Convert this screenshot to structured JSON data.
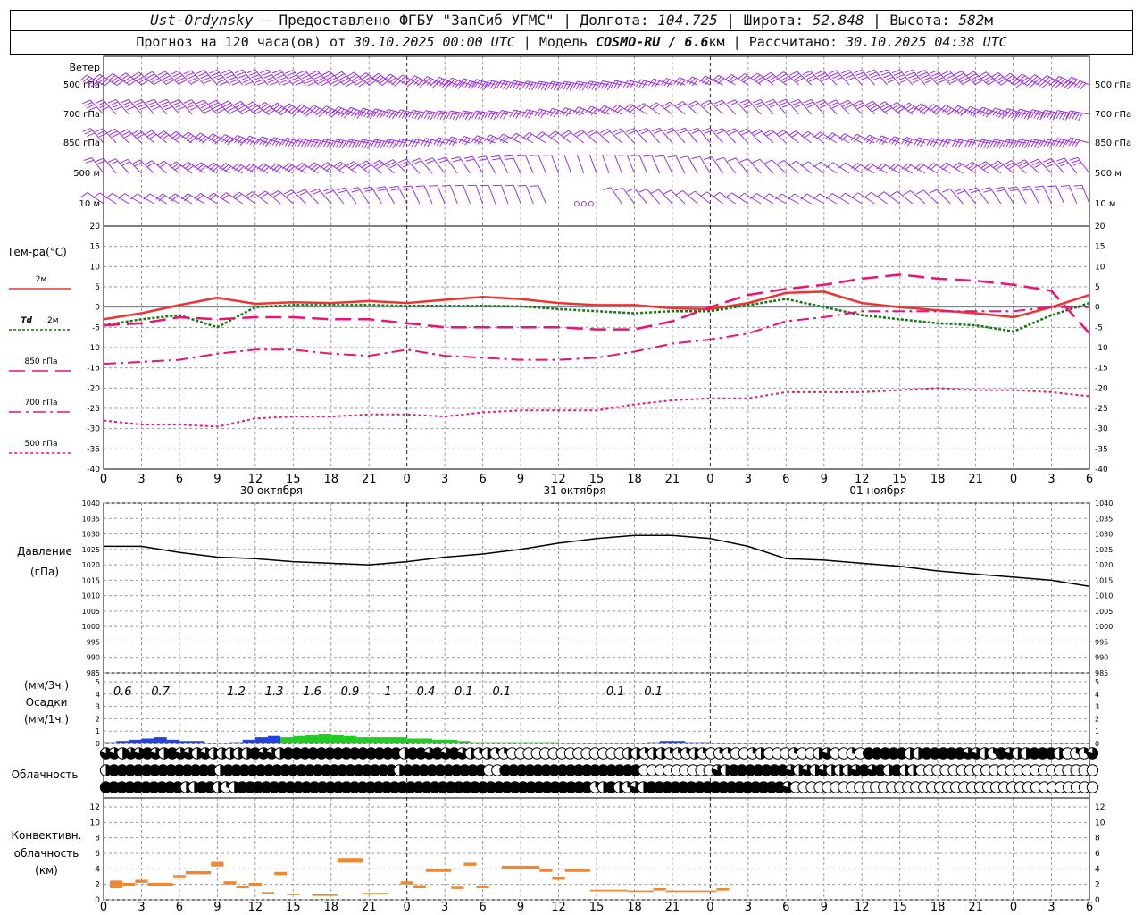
{
  "header": {
    "station": "Ust-Ordynsky",
    "provider": "— Предоставлено ФГБУ \"ЗапСиб УГМС\"",
    "lon_label": "Долгота:",
    "lon_value": "104.725",
    "lat_label": "Широта:",
    "lat_value": "52.848",
    "alt_label": "Высота:",
    "alt_value": "582",
    "alt_unit": "м",
    "forecast_label": "Прогноз на 120 часа(ов) от",
    "forecast_start": "30.10.2025 00:00 UTC",
    "model_label": "Модель",
    "model_name": "COSMO-RU / 6.6",
    "model_unit": "км",
    "computed_label": "Рассчитано:",
    "computed_value": "30.10.2025 04:38 UTC"
  },
  "labels": {
    "wind": "Ветер",
    "temp": "Тем-ра(°C)",
    "t2m": "2м",
    "td_a": "Td",
    "td_b": "2м",
    "t850": "850 гПа",
    "t700": "700 гПа",
    "t500": "500 гПа",
    "pressure_a": "Давление",
    "pressure_b": "(гПа)",
    "precip_a": "(мм/3ч.)",
    "precip_b": "Осадки",
    "precip_c": "(мм/1ч.)",
    "cloud": "Облачность",
    "conv_a": "Конвективн.",
    "conv_b": "облачность",
    "conv_c": "(км)"
  },
  "colors": {
    "wind": "#9b30e8",
    "t2m": "#ee3333",
    "td": "#117711",
    "t_upper": "#ee1177",
    "precip_light": "#2244dd",
    "precip_heavy": "#22cc22",
    "convective": "#ee8833",
    "pressure": "#000000",
    "grid": "#999999"
  },
  "chart_data": {
    "type": "line",
    "x_hours_utc": [
      0,
      3,
      6,
      9,
      12,
      15,
      18,
      21,
      0,
      3,
      6,
      9,
      12,
      15,
      18,
      21,
      0,
      3,
      6,
      9,
      12,
      15,
      18,
      21,
      0,
      3,
      6
    ],
    "dates": [
      "30 октября",
      "31 октября",
      "01 ноября"
    ],
    "wind": {
      "levels": [
        "500 гПа",
        "700 гПа",
        "850 гПа",
        "500 м",
        "10 м"
      ],
      "right_levels": [
        "500 гПа",
        "700 гПа",
        "850 гПа",
        "500 м",
        "10 м"
      ]
    },
    "temperature": {
      "ylim": [
        -40,
        20
      ],
      "ticks": [
        20,
        15,
        10,
        5,
        0,
        -5,
        -10,
        -15,
        -20,
        -25,
        -30,
        -35,
        -40
      ],
      "x": [
        0,
        3,
        6,
        9,
        12,
        15,
        18,
        21,
        24,
        27,
        30,
        33,
        36,
        39,
        42,
        45,
        48,
        51,
        54,
        57,
        60,
        63,
        66,
        69,
        72,
        75,
        78
      ],
      "series": [
        {
          "name": "2м",
          "values": [
            -3,
            -1.5,
            0.5,
            2.3,
            0.8,
            1.2,
            1,
            1.5,
            1,
            1.8,
            2.5,
            2,
            1,
            0.5,
            0.5,
            -0.3,
            -0.5,
            1,
            3.5,
            3.8,
            1,
            0,
            -0.8,
            -1.5,
            -2.5,
            0,
            3
          ]
        },
        {
          "name": "Td 2м",
          "values": [
            -4.5,
            -3,
            -2,
            -5,
            0,
            0.5,
            0.5,
            0.5,
            0.3,
            0.3,
            0.3,
            0.2,
            -0.5,
            -1,
            -1.5,
            -1,
            -1,
            0.5,
            2,
            0,
            -2,
            -3,
            -4,
            -4.5,
            -6,
            -2,
            1
          ]
        },
        {
          "name": "850 гПа",
          "values": [
            -4.5,
            -4,
            -2.5,
            -3,
            -2.5,
            -2.5,
            -3,
            -3,
            -4,
            -5,
            -5,
            -5,
            -5,
            -5.5,
            -5.5,
            -3.5,
            0,
            3,
            4.5,
            5.5,
            7,
            8,
            7,
            6.5,
            5.5,
            4,
            -6.5
          ]
        },
        {
          "name": "700 гПа",
          "values": [
            -14,
            -13.5,
            -13,
            -11.5,
            -10.5,
            -10.5,
            -11.5,
            -12,
            -10.5,
            -12,
            -12.5,
            -13,
            -13,
            -12.5,
            -11,
            -9,
            -8,
            -6.5,
            -3.5,
            -2.5,
            -1,
            -1,
            -1,
            -1,
            -1,
            0,
            0
          ]
        },
        {
          "name": "500 гПа",
          "values": [
            -28,
            -29,
            -29,
            -29.5,
            -27.5,
            -27,
            -27,
            -26.5,
            -26.5,
            -27,
            -26,
            -25.5,
            -25.5,
            -25.5,
            -24,
            -23,
            -22.5,
            -22.5,
            -21,
            -21,
            -21,
            -20.5,
            -20,
            -20.5,
            -20.5,
            -21,
            -22
          ]
        }
      ]
    },
    "pressure": {
      "ylim": [
        985,
        1040
      ],
      "ticks": [
        1040,
        1035,
        1030,
        1025,
        1020,
        1015,
        1010,
        1005,
        1000,
        995,
        990,
        985
      ],
      "x": [
        0,
        3,
        6,
        9,
        12,
        15,
        18,
        21,
        24,
        27,
        30,
        33,
        36,
        39,
        42,
        45,
        48,
        51,
        54,
        57,
        60,
        63,
        66,
        69,
        72,
        75,
        78
      ],
      "values": [
        1026,
        1026,
        1024,
        1022.5,
        1022,
        1021,
        1020.5,
        1020,
        1021,
        1022.5,
        1023.5,
        1025,
        1027,
        1028.5,
        1029.5,
        1029.5,
        1028.5,
        1026,
        1022,
        1021.5,
        1020.5,
        1019.5,
        1018,
        1017,
        1016,
        1015,
        1013
      ]
    },
    "precipitation": {
      "ylim": [
        0,
        5
      ],
      "ticks": [
        5,
        4,
        3,
        2,
        1,
        0
      ],
      "totals_3h": [
        {
          "hour": 1.5,
          "value": "0.6"
        },
        {
          "hour": 4.5,
          "value": "0.7"
        },
        {
          "hour": 10.5,
          "value": "1.2"
        },
        {
          "hour": 13.5,
          "value": "1.3"
        },
        {
          "hour": 16.5,
          "value": "1.6"
        },
        {
          "hour": 19.5,
          "value": "0.9"
        },
        {
          "hour": 22.5,
          "value": "1"
        },
        {
          "hour": 25.5,
          "value": "0.4"
        },
        {
          "hour": 28.5,
          "value": "0.1"
        },
        {
          "hour": 31.5,
          "value": "0.1"
        },
        {
          "hour": 40.5,
          "value": "0.1"
        },
        {
          "hour": 43.5,
          "value": "0.1"
        }
      ],
      "hourly_light": [
        0.1,
        0.2,
        0.3,
        0.4,
        0.5,
        0.3,
        0.2,
        0.2,
        0,
        0,
        0.1,
        0.3,
        0.5,
        0.6,
        0.4,
        0.3,
        0.3,
        0.3,
        0.2,
        0.2,
        0.2,
        0.2,
        0.3,
        0.3,
        0.2,
        0.1,
        0.1,
        0,
        0,
        0,
        0,
        0,
        0,
        0,
        0,
        0,
        0,
        0,
        0,
        0,
        0,
        0,
        0,
        0.1,
        0.2,
        0.2,
        0.1,
        0.1
      ],
      "hourly_heavy": [
        0,
        0,
        0,
        0,
        0,
        0,
        0,
        0,
        0,
        0,
        0,
        0,
        0,
        0,
        0.5,
        0.6,
        0.7,
        0.8,
        0.7,
        0.6,
        0.5,
        0.5,
        0.5,
        0.5,
        0.4,
        0.4,
        0.3,
        0.3,
        0.2,
        0.1,
        0.1,
        0.1,
        0.1,
        0.1,
        0.1,
        0.1,
        0,
        0,
        0,
        0,
        0,
        0,
        0,
        0,
        0,
        0,
        0,
        0
      ]
    },
    "cloudiness": {
      "rows": 3,
      "note": "fraction of cloud cover per hour (0..1), rows top=high, middle=mid, bottom=low",
      "high": [
        0.8,
        0.8,
        0.5,
        0.9,
        0.8,
        1,
        0.8,
        0.5,
        1,
        0.8,
        0.8,
        0.5,
        0.8,
        0.5,
        0.5,
        0.5,
        0.5,
        0.5,
        1,
        0.8,
        0.8,
        0.5,
        1,
        1,
        1,
        1,
        1,
        1,
        1,
        1,
        1,
        1,
        1,
        1,
        1,
        1,
        0.5,
        1,
        1,
        0.8,
        1,
        0.8,
        1,
        0.8,
        0.5,
        0.3,
        0.5,
        0.3,
        0.3,
        0,
        0,
        0,
        0,
        0,
        0,
        0,
        0,
        0,
        0,
        0,
        0,
        0,
        0,
        0.5,
        0.5,
        0.3,
        0.5,
        0.5,
        0.3,
        0.3,
        0.3,
        0.5,
        0.3,
        0,
        0.3,
        0.3,
        0,
        0,
        0.3,
        0.5,
        0,
        0,
        0,
        0.3,
        0,
        0,
        0.5,
        0.8,
        0,
        0,
        0.3,
        0,
        1,
        1,
        1,
        1,
        1,
        0.5,
        0.5,
        1,
        1,
        1,
        1,
        1,
        0.8,
        0.8,
        0.5,
        0.3,
        1,
        0.8,
        0.5,
        0.5,
        1,
        1,
        1,
        0.5,
        0,
        0.3,
        0.3,
        0.8
      ],
      "mid": [
        0.5,
        1,
        1,
        1,
        1,
        1,
        1,
        1,
        1,
        1,
        1,
        1,
        1,
        1,
        0.5,
        1,
        1,
        1,
        1,
        1,
        1,
        1,
        1,
        1,
        1,
        1,
        1,
        1,
        1,
        1,
        1,
        1,
        1,
        1,
        1,
        1,
        0.5,
        1,
        1,
        1,
        1,
        1,
        1,
        1,
        1,
        1,
        1,
        0,
        0,
        1,
        1,
        1,
        1,
        1,
        1,
        1,
        1,
        1,
        1,
        1,
        1,
        1,
        1,
        1,
        1,
        1,
        0,
        0,
        0,
        0,
        0,
        0,
        0,
        0,
        0,
        0.8,
        0.5,
        1,
        1,
        1,
        1,
        1,
        1,
        1,
        0.8,
        0.5,
        0.8,
        0.5,
        0.8,
        0.5,
        0.5,
        0.5,
        0.8,
        1,
        0.8,
        1,
        0.5,
        1,
        0.5,
        0.5,
        0,
        0,
        0,
        0,
        0,
        0,
        0,
        0,
        0,
        0,
        0,
        0,
        0,
        0,
        0,
        0,
        0,
        0,
        0,
        0,
        0,
        0
      ],
      "low": [
        1,
        1,
        1,
        1,
        1,
        1,
        1,
        1,
        1,
        1,
        0.5,
        0.5,
        1,
        1,
        0.5,
        0.3,
        0.5,
        1,
        1,
        1,
        1,
        1,
        1,
        1,
        1,
        1,
        1,
        1,
        1,
        1,
        1,
        1,
        1,
        1,
        1,
        1,
        1,
        1,
        1,
        1,
        1,
        1,
        1,
        1,
        1,
        1,
        1,
        1,
        1,
        1,
        1,
        1,
        1,
        1,
        1,
        1,
        1,
        1,
        1,
        1,
        1,
        0.3,
        0.5,
        1,
        0.5,
        0.3,
        0.8,
        0.5,
        1,
        1,
        1,
        1,
        1,
        1,
        1,
        1,
        1,
        1,
        1,
        1,
        1,
        1,
        1,
        1,
        1,
        0.8,
        0,
        0,
        0,
        0,
        0,
        0,
        0,
        0,
        0,
        0,
        0,
        0,
        0,
        0,
        0,
        0,
        0,
        0,
        0,
        0,
        0,
        0,
        0,
        0,
        0,
        0,
        0,
        0,
        0,
        0,
        0,
        0,
        0,
        0,
        0,
        0,
        0,
        0
      ]
    },
    "convective": {
      "ylim": [
        0,
        12
      ],
      "ticks": [
        12,
        10,
        8,
        6,
        4,
        2,
        0
      ],
      "segments": [
        {
          "start": 0.5,
          "end": 1.5,
          "base": 1.5,
          "top": 2.5
        },
        {
          "start": 1.5,
          "end": 2.5,
          "base": 1.8,
          "top": 2.2
        },
        {
          "start": 2.5,
          "end": 3.5,
          "base": 2.2,
          "top": 2.6
        },
        {
          "start": 3.5,
          "end": 5.5,
          "base": 1.8,
          "top": 2.2
        },
        {
          "start": 5.5,
          "end": 6.5,
          "base": 2.8,
          "top": 3.2
        },
        {
          "start": 6.5,
          "end": 8.5,
          "base": 3.3,
          "top": 3.7
        },
        {
          "start": 8.5,
          "end": 9.5,
          "base": 4.3,
          "top": 4.9
        },
        {
          "start": 9.5,
          "end": 10.5,
          "base": 2,
          "top": 2.4
        },
        {
          "start": 10.5,
          "end": 11.5,
          "base": 1.5,
          "top": 1.8
        },
        {
          "start": 11.5,
          "end": 12.5,
          "base": 1.8,
          "top": 2.2
        },
        {
          "start": 12.5,
          "end": 13.5,
          "base": 0.8,
          "top": 1.0
        },
        {
          "start": 13.5,
          "end": 14.5,
          "base": 3.2,
          "top": 3.6
        },
        {
          "start": 14.5,
          "end": 15.5,
          "base": 0.6,
          "top": 0.8
        },
        {
          "start": 16.5,
          "end": 18.5,
          "base": 0.5,
          "top": 0.7
        },
        {
          "start": 18.5,
          "end": 20.5,
          "base": 4.8,
          "top": 5.4
        },
        {
          "start": 20.5,
          "end": 22.5,
          "base": 0.7,
          "top": 0.9
        },
        {
          "start": 23.5,
          "end": 24.5,
          "base": 2.0,
          "top": 2.4
        },
        {
          "start": 24.5,
          "end": 25.5,
          "base": 1.5,
          "top": 1.9
        },
        {
          "start": 25.5,
          "end": 27.5,
          "base": 3.6,
          "top": 4.0
        },
        {
          "start": 27.5,
          "end": 28.5,
          "base": 1.4,
          "top": 1.7
        },
        {
          "start": 28.5,
          "end": 29.5,
          "base": 4.4,
          "top": 4.8
        },
        {
          "start": 29.5,
          "end": 30.5,
          "base": 1.5,
          "top": 1.8
        },
        {
          "start": 31.5,
          "end": 34.5,
          "base": 4.0,
          "top": 4.4
        },
        {
          "start": 34.5,
          "end": 35.5,
          "base": 3.6,
          "top": 4.0
        },
        {
          "start": 35.5,
          "end": 36.5,
          "base": 2.6,
          "top": 3.0
        },
        {
          "start": 36.5,
          "end": 38.5,
          "base": 3.6,
          "top": 4.0
        },
        {
          "start": 38.5,
          "end": 41.5,
          "base": 1.1,
          "top": 1.3
        },
        {
          "start": 41.5,
          "end": 43.5,
          "base": 1.0,
          "top": 1.2
        },
        {
          "start": 43.5,
          "end": 44.5,
          "base": 1.2,
          "top": 1.5
        },
        {
          "start": 44.5,
          "end": 48.5,
          "base": 1.0,
          "top": 1.2
        },
        {
          "start": 48.5,
          "end": 49.5,
          "base": 1.2,
          "top": 1.5
        }
      ]
    }
  }
}
